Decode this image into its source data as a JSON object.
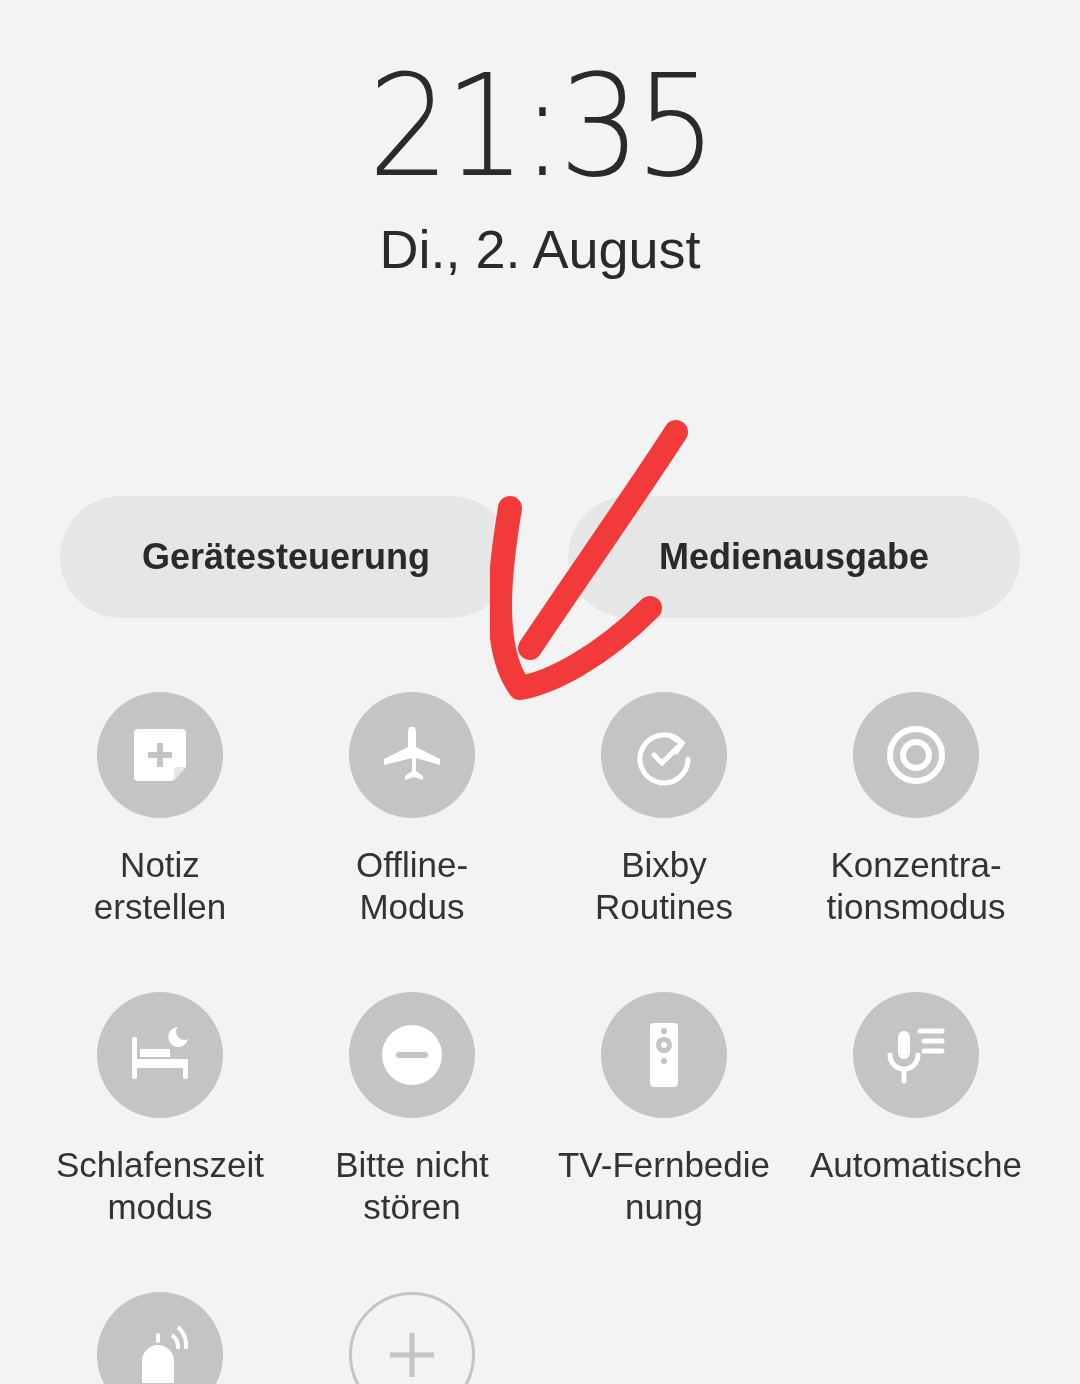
{
  "clock": {
    "time": "21:35",
    "date": "Di., 2. August"
  },
  "pills": [
    {
      "label": "Gerätesteuerung"
    },
    {
      "label": "Medienausgabe"
    }
  ],
  "tiles": [
    {
      "kind": "toggle",
      "on": false,
      "lines": [
        "Notiz",
        "erstellen"
      ]
    },
    {
      "kind": "toggle",
      "on": false,
      "lines": [
        "Offline-",
        "Modus"
      ]
    },
    {
      "kind": "toggle",
      "on": false,
      "lines": [
        "Bixby",
        "Routines"
      ]
    },
    {
      "kind": "toggle",
      "on": false,
      "lines": [
        "Konzentra-",
        "tionsmodus"
      ]
    },
    {
      "kind": "toggle",
      "on": false,
      "lines": [
        "Schlafenszeit",
        "modus"
      ]
    },
    {
      "kind": "toggle",
      "on": false,
      "lines": [
        "Bitte nicht",
        "stören"
      ]
    },
    {
      "kind": "toggle",
      "on": false,
      "lines": [
        "TV-Fernbedie",
        "nung"
      ]
    },
    {
      "kind": "toggle",
      "on": false,
      "lines": [
        "Automatische"
      ]
    },
    {
      "kind": "toggle",
      "on": false
    },
    {
      "kind": "add"
    }
  ]
}
